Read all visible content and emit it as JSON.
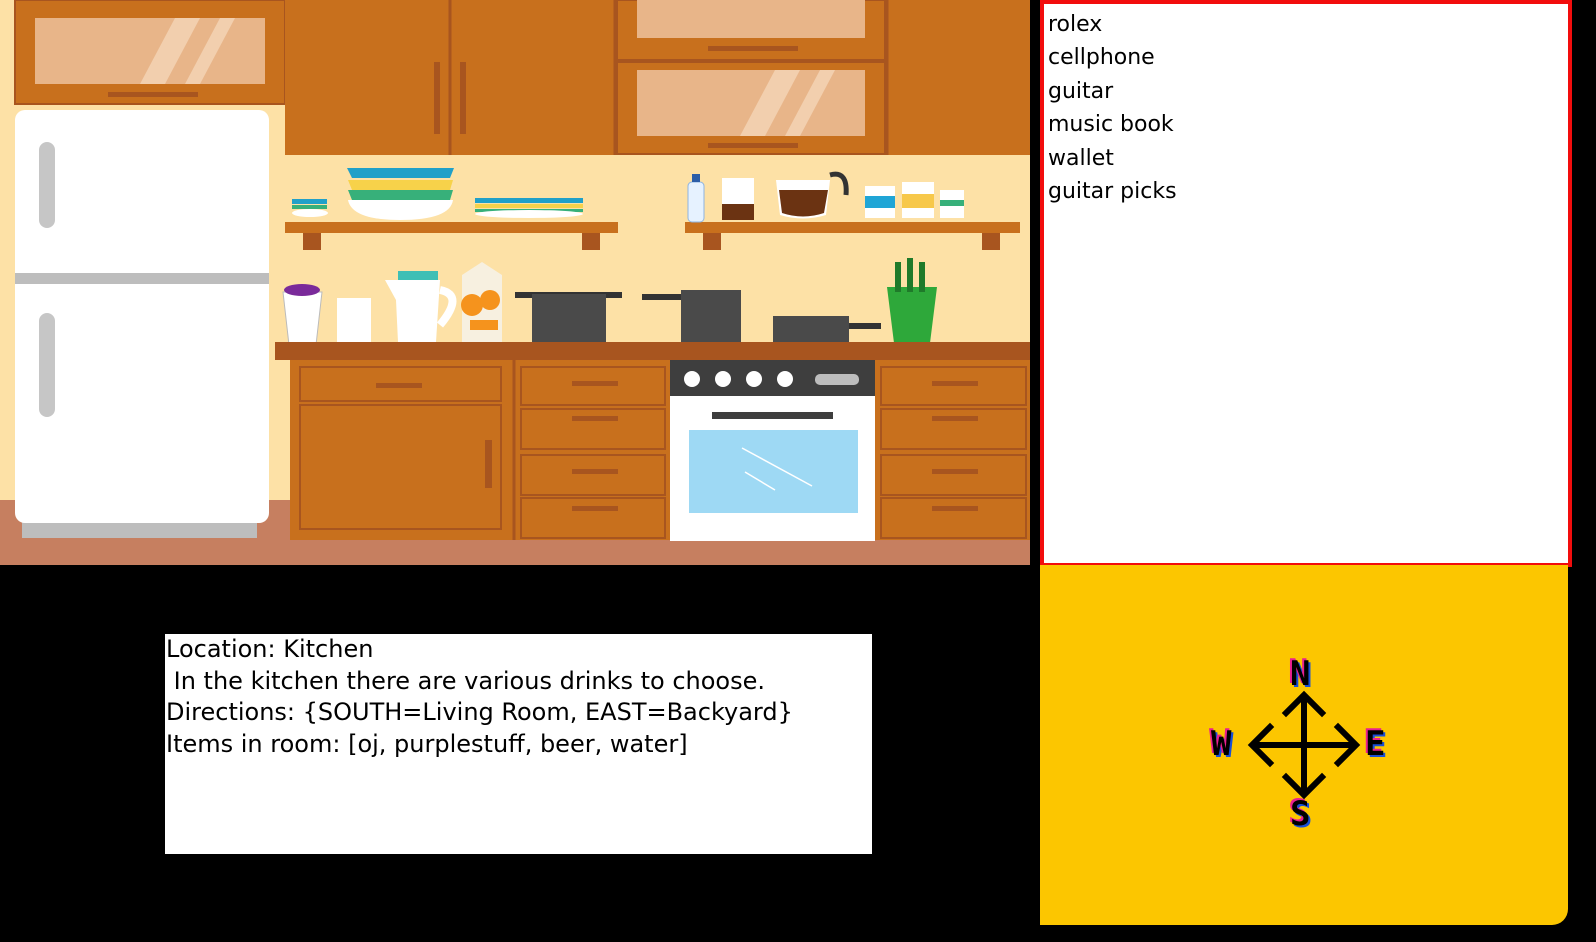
{
  "inventory": {
    "items": [
      "rolex",
      "cellphone",
      "guitar",
      "music book",
      "wallet",
      "guitar picks"
    ]
  },
  "status": {
    "location_line": "Location: Kitchen",
    "description_line": " In the kitchen there are various drinks to choose.",
    "directions_line": "Directions: {SOUTH=Living Room, EAST=Backyard}",
    "items_line": "Items in room: [oj, purplestuff, beer, water]"
  },
  "compass": {
    "north": "N",
    "south": "S",
    "east": "E",
    "west": "W"
  },
  "colors": {
    "wall": "#fde1a6",
    "cabinet": "#c8701d",
    "counter": "#a8551f",
    "floor": "#c67f60",
    "inventory_border": "#f20d0d",
    "compass_panel": "#fcc600"
  },
  "scene": {
    "room": "kitchen"
  }
}
